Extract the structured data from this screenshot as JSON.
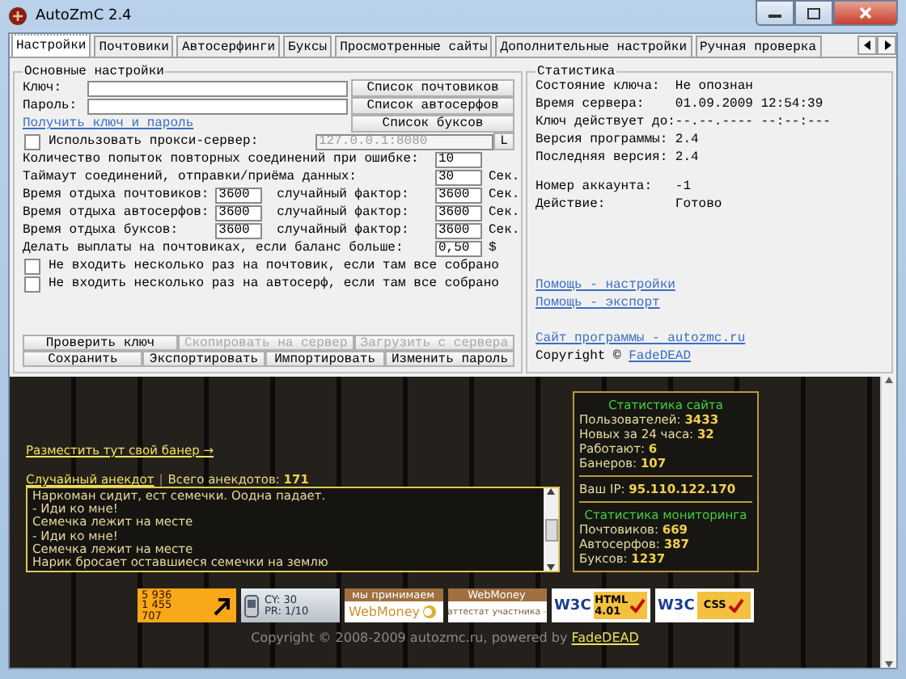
{
  "window": {
    "title": "AutoZmC 2.4"
  },
  "tabs": [
    {
      "label": "Настройки",
      "selected": true
    },
    {
      "label": "Почтовики",
      "selected": false
    },
    {
      "label": "Автосерфинги",
      "selected": false
    },
    {
      "label": "Буксы",
      "selected": false
    },
    {
      "label": "Просмотренные сайты",
      "selected": false
    },
    {
      "label": "Дополнительные настройки",
      "selected": false
    },
    {
      "label": "Ручная проверка",
      "selected": false
    }
  ],
  "settings": {
    "title": "Основные настройки",
    "key_label": "Ключ:",
    "password_label": "Пароль:",
    "get_key_link": "Получить ключ и пароль",
    "list_buttons": [
      "Список почтовиков",
      "Список автосерфов",
      "Список буксов"
    ],
    "proxy": {
      "label": "Использовать прокси-сервер:",
      "checked": false,
      "value": "127.0.0.1:8080",
      "button": "L"
    },
    "retries": {
      "label": "Количество попыток повторных соединений при ошибке:",
      "value": "10"
    },
    "timeout": {
      "label": "Таймаут соединений, отправки/приёма данных:",
      "value": "30",
      "unit": "Сек."
    },
    "rest": [
      {
        "label": "Время отдыха почтовиков:",
        "value": "3600",
        "random_label": "случайный фактор:",
        "random_value": "3600",
        "unit": "Сек."
      },
      {
        "label": "Время отдыха автосерфов:",
        "value": "3600",
        "random_label": "случайный фактор:",
        "random_value": "3600",
        "unit": "Сек."
      },
      {
        "label": "Время отдыха буксов:",
        "value": "3600",
        "random_label": "случайный фактор:",
        "random_value": "3600",
        "unit": "Сек."
      }
    ],
    "payout": {
      "label": "Делать выплаты на почтовиках, если баланс больше:",
      "value": "0,50",
      "unit": "$"
    },
    "options": [
      {
        "label": "Не входить несколько раз на почтовик, если там все собрано",
        "checked": false
      },
      {
        "label": "Не входить несколько раз на автосерф, если там все собрано",
        "checked": false
      }
    ],
    "actions": [
      [
        {
          "label": "Проверить ключ",
          "disabled": false
        },
        {
          "label": "Скопировать на сервер",
          "disabled": true
        },
        {
          "label": "Загрузить с сервера",
          "disabled": true
        }
      ],
      [
        {
          "label": "Сохранить",
          "disabled": false
        },
        {
          "label": "Экспортировать",
          "disabled": false
        },
        {
          "label": "Импортировать",
          "disabled": false
        },
        {
          "label": "Изменить пароль",
          "disabled": false
        }
      ]
    ]
  },
  "stats": {
    "title": "Статистика",
    "row_groups": [
      {
        "rows": [
          {
            "label": "Состояние ключа:",
            "value": "Не опознан"
          },
          {
            "label": "Время сервера:",
            "value": "01.09.2009 12:54:39"
          },
          {
            "label": "Ключ действует до:",
            "value": "--.--.---- --:--:---"
          },
          {
            "label": "Версия программы:",
            "value": "2.4"
          },
          {
            "label": "Последняя версия:",
            "value": "2.4"
          }
        ]
      },
      {
        "rows": [
          {
            "label": "Номер аккаунта:",
            "value": "-1"
          },
          {
            "label": "Действие:",
            "value": "Готово"
          }
        ]
      }
    ],
    "help_links": [
      "Помощь - настройки",
      "Помощь - экспорт"
    ],
    "site_link": "Сайт программы - autozmc.ru",
    "copyright": {
      "text": "Copyright © ",
      "author": "FadeDEAD"
    }
  },
  "web": {
    "banner_link": "Разместить тут свой банер →",
    "joke_link": "Случайный анекдот",
    "separator": "|",
    "joke_count": "Всего анекдотов: **171**",
    "joke_lines": [
      "Наркоман сидит, ест семечки. Оодна падает.",
      "- Иди ко мне!",
      "Семечка лежит на месте",
      "- Иди ко мне!",
      "Семечка лежит на месте",
      "Нарик бросает оставшиеся семечки на землю"
    ],
    "site_stats": {
      "title": "Статистика сайта",
      "rows": [
        "Пользователей: **3433**",
        "Новых за 24 часа: **32**",
        "Работают: **6**",
        "Банеров: **107**"
      ],
      "ip": "Ваш IP: **95.110.122.170**",
      "monitor_title": "Статистика мониторинга",
      "monitor_rows": [
        "Почтовиков: **669**",
        "Автосерфов: **387**",
        "Буксов: **1237**"
      ]
    },
    "badges": [
      {
        "kind": "counter",
        "lines": [
          "5 936",
          "1 455",
          "707"
        ]
      },
      {
        "kind": "cy",
        "lines": [
          "CY: 30",
          "PR: 1/10"
        ]
      },
      {
        "kind": "webmoney",
        "lines": [
          "мы принимаем",
          "WebMoney"
        ]
      },
      {
        "kind": "attestat",
        "lines": [
          "WebMoney",
          "аттестат участника"
        ]
      },
      {
        "kind": "w3c",
        "lines": [
          "W3C",
          "HTML",
          "4.01"
        ]
      },
      {
        "kind": "w3c",
        "lines": [
          "W3C",
          "CSS"
        ]
      }
    ],
    "copyright": {
      "text": "Copyright © 2008-2009 autozmc.ru, powered by ",
      "author": "FadeDEAD"
    }
  }
}
